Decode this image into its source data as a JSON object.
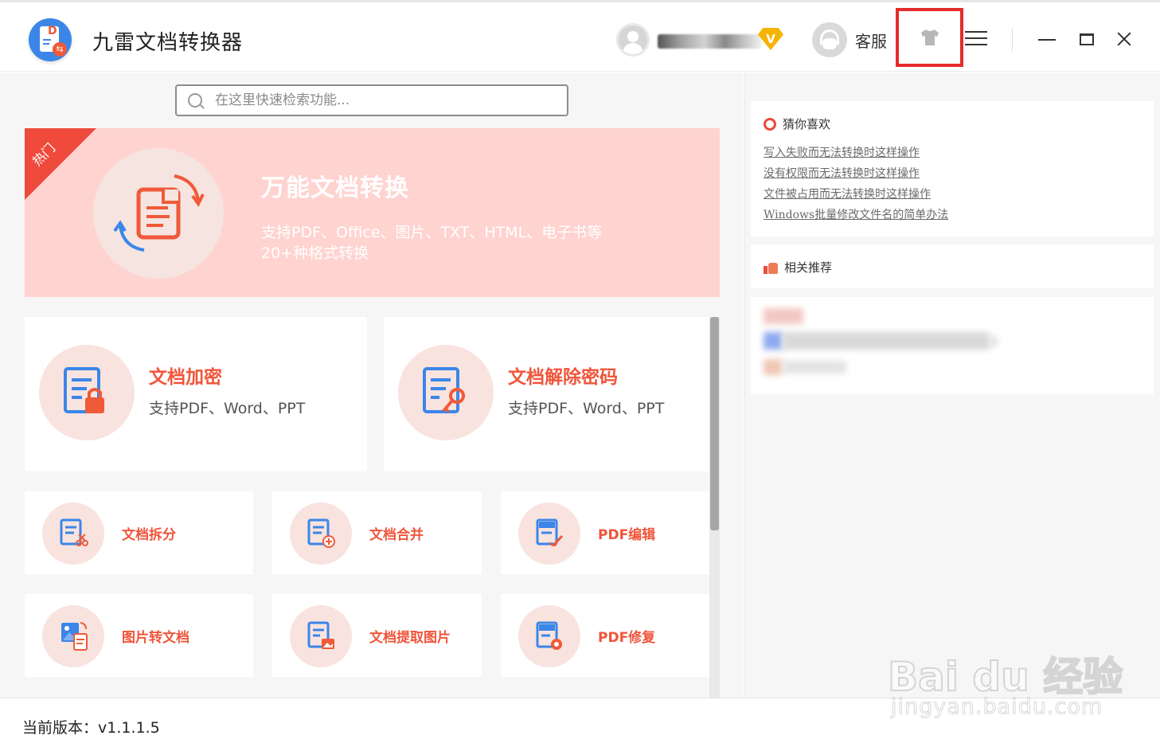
{
  "app": {
    "title": "九雷文档转换器"
  },
  "header": {
    "vip_label": "V",
    "support_label": "客服"
  },
  "search": {
    "placeholder": "在这里快速检索功能..."
  },
  "banner": {
    "ribbon": "热门",
    "title": "万能文档转换",
    "desc_line1": "支持PDF、Office、图片、TXT、HTML、电子书等",
    "desc_line2": "20+种格式转换"
  },
  "features_large": [
    {
      "title": "文档加密",
      "desc": "支持PDF、Word、PPT",
      "icon": "document-lock-icon"
    },
    {
      "title": "文档解除密码",
      "desc": "支持PDF、Word、PPT",
      "icon": "document-key-icon"
    }
  ],
  "features_small": [
    {
      "title": "文档拆分",
      "icon": "document-split-icon"
    },
    {
      "title": "文档合并",
      "icon": "document-merge-icon"
    },
    {
      "title": "PDF编辑",
      "icon": "pdf-edit-icon"
    },
    {
      "title": "图片转文档",
      "icon": "image-to-doc-icon"
    },
    {
      "title": "文档提取图片",
      "icon": "extract-image-icon"
    },
    {
      "title": "PDF修复",
      "icon": "pdf-repair-icon"
    }
  ],
  "sidebar": {
    "guess_title": "猜你喜欢",
    "guess_links": [
      "写入失败而无法转换时这样操作",
      "没有权限而无法转换时这样操作",
      "文件被占用而无法转换时这样操作",
      "Windows批量修改文件名的简单办法"
    ],
    "related_title": "相关推荐"
  },
  "footer": {
    "version": "当前版本：v1.1.1.5"
  },
  "watermark": {
    "main": "Bai du 经验",
    "sub": "jingyan.baidu.com"
  },
  "colors": {
    "accent": "#f0553b",
    "banner_bg": "#ffd3d0",
    "icon_blue": "#3b86e8",
    "highlight_box": "#e52b2b"
  }
}
